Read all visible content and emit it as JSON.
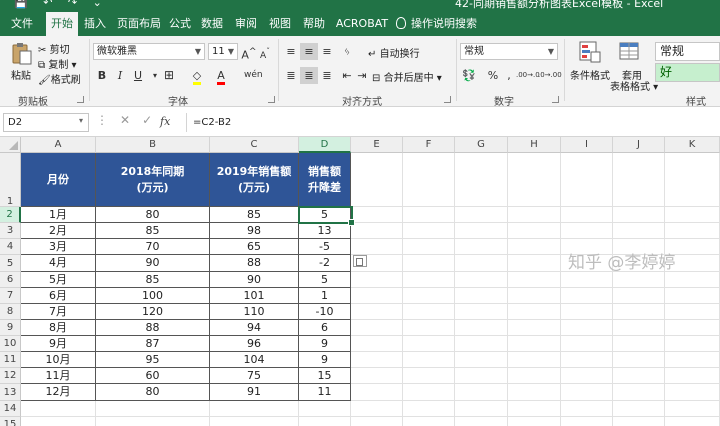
{
  "titlebar": {
    "quick_access": "💾 ↶ ↷ ⌄",
    "title": "42-同期销售额分析图表Excel模板 - Excel"
  },
  "tabs": [
    "文件",
    "开始",
    "插入",
    "页面布局",
    "公式",
    "数据",
    "审阅",
    "视图",
    "帮助",
    "ACROBAT",
    "操作说明搜索"
  ],
  "active_tab": "开始",
  "ribbon": {
    "clipboard": {
      "paste": "粘贴",
      "cut": "剪切",
      "copy": "复制",
      "format_painter": "格式刷",
      "label": "剪贴板"
    },
    "font": {
      "name": "微软雅黑",
      "size": "11",
      "grow": "A",
      "shrink": "A",
      "bold": "B",
      "italic": "I",
      "underline": "U",
      "label": "字体",
      "wen": "wén"
    },
    "alignment": {
      "wrap": "自动换行",
      "merge": "合并后居中",
      "label": "对齐方式"
    },
    "number": {
      "format": "常规",
      "percent": "%",
      "comma": ",",
      "label": "数字",
      "dec_inc": ".00→.0",
      "dec_dec": ".0→.00"
    },
    "styles": {
      "conditional": "条件格式",
      "table_format_1": "套用",
      "table_format_2": "表格格式",
      "normal": "常规",
      "good": "好",
      "label": "样式"
    }
  },
  "formula_bar": {
    "name_box": "D2",
    "formula": "=C2-B2"
  },
  "columns": [
    "A",
    "B",
    "C",
    "D",
    "E",
    "F",
    "G",
    "H",
    "I",
    "J",
    "K"
  ],
  "rows": [
    "1",
    "2",
    "3",
    "4",
    "5",
    "6",
    "7",
    "8",
    "9",
    "10",
    "11",
    "12",
    "13",
    "14",
    "15"
  ],
  "table": {
    "headers": [
      "月份",
      "2018年同期\n(万元)",
      "2019年销售额\n(万元)",
      "销售额\n升降差"
    ],
    "data": [
      [
        "1月",
        "80",
        "85",
        "5"
      ],
      [
        "2月",
        "85",
        "98",
        "13"
      ],
      [
        "3月",
        "70",
        "65",
        "-5"
      ],
      [
        "4月",
        "90",
        "88",
        "-2"
      ],
      [
        "5月",
        "85",
        "90",
        "5"
      ],
      [
        "6月",
        "100",
        "101",
        "1"
      ],
      [
        "7月",
        "120",
        "110",
        "-10"
      ],
      [
        "8月",
        "88",
        "94",
        "6"
      ],
      [
        "9月",
        "87",
        "96",
        "9"
      ],
      [
        "10月",
        "95",
        "104",
        "9"
      ],
      [
        "11月",
        "60",
        "75",
        "15"
      ],
      [
        "12月",
        "80",
        "91",
        "11"
      ]
    ]
  },
  "watermark": "知乎 @李婷婷",
  "colors": {
    "excel_green": "#217346",
    "header_fill": "#2f5597",
    "selection_fill": "#d3f0e0",
    "good_fill": "#c6efce"
  }
}
